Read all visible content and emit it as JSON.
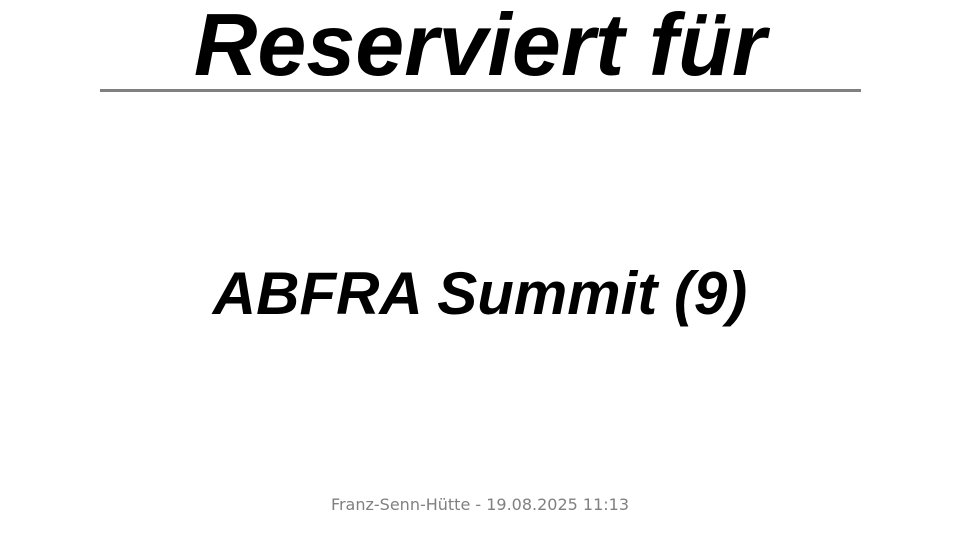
{
  "sign": {
    "title": "Reserviert für",
    "reserved_for": "ABFRA Summit (9)",
    "footer": "Franz-Senn-Hütte - 19.08.2025 11:13"
  },
  "colors": {
    "text": "#000000",
    "divider": "#808080",
    "footer_text": "#808080",
    "background": "#ffffff"
  }
}
